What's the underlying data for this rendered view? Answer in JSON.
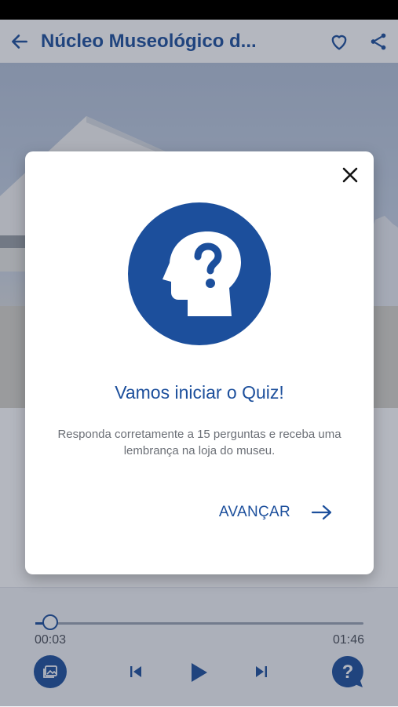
{
  "header": {
    "back_icon": "arrow-left-icon",
    "title": "Núcleo Museológico d...",
    "favorite_icon": "heart-outline-icon",
    "share_icon": "share-icon"
  },
  "player": {
    "current_time": "00:03",
    "total_time": "01:46",
    "progress": 0.03,
    "gallery_icon": "image-gallery-icon",
    "prev_icon": "skip-previous-icon",
    "play_icon": "play-icon",
    "next_icon": "skip-next-icon",
    "quiz_icon": "question-bubble-icon"
  },
  "modal": {
    "close_icon": "close-icon",
    "illustration_icon": "head-question-icon",
    "title": "Vamos iniciar o Quiz!",
    "description": "Responda corretamente a 15 perguntas e receba uma lembrança na loja do museu.",
    "advance_label": "AVANÇAR",
    "advance_icon": "arrow-right-icon"
  },
  "colors": {
    "brand": "#1c4f9c",
    "overlay": "rgba(40,50,72,0.35)"
  }
}
